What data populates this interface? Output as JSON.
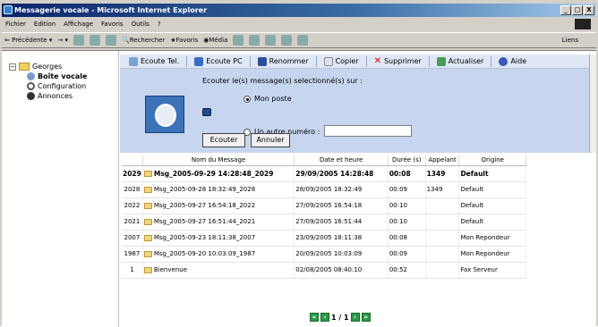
{
  "window": {
    "title": "Messagerie vocale - Microsoft Internet Explorer",
    "buttons": [
      "_",
      "□",
      "X"
    ]
  },
  "menu": [
    "Fichier",
    "Edition",
    "Affichage",
    "Favoris",
    "Outils",
    "?"
  ],
  "nav": {
    "back": "Précédente",
    "search": "Rechercher",
    "favorites": "Favoris",
    "media": "Média",
    "links": "Liens"
  },
  "tree": {
    "root": "Georges",
    "items": [
      "Boîte vocale",
      "Configuration",
      "Annonces"
    ]
  },
  "toolbar": {
    "items": [
      "Ecoute Tel.",
      "Ecoute PC",
      "Renommer",
      "Copier",
      "Supprimer",
      "Actualiser",
      "Aide"
    ]
  },
  "panel": {
    "question": "Ecouter le(s) message(s) selectionné(s) sur :",
    "option1": "Mon poste",
    "option2": "Un autre numéro :",
    "number_value": "",
    "listen_button": "Ecouter",
    "cancel_button": "Annuler"
  },
  "table": {
    "headers": [
      "",
      "Nom du Message",
      "Date et heure",
      "Durée (s)",
      "Appelant",
      "Origine"
    ],
    "rows": [
      {
        "id": "2029",
        "name": "Msg_2005-09-29 14:28:48_2029",
        "date": "29/09/2005 14:28:48",
        "duration": "00:08",
        "caller": "1349",
        "origin": "Default",
        "bold": true
      },
      {
        "id": "2028",
        "name": "Msg_2005-09-28 18:32:49_2028",
        "date": "28/09/2005 18:32:49",
        "duration": "00:09",
        "caller": "1349",
        "origin": "Default"
      },
      {
        "id": "2022",
        "name": "Msg_2005-09-27 16:54:18_2022",
        "date": "27/09/2005 16:54:18",
        "duration": "00:10",
        "caller": "",
        "origin": "Default"
      },
      {
        "id": "2021",
        "name": "Msg_2005-09-27 16:51:44_2021",
        "date": "27/09/2005 16:51:44",
        "duration": "00:10",
        "caller": "",
        "origin": "Default"
      },
      {
        "id": "2007",
        "name": "Msg_2005-09-23 18:11:38_2007",
        "date": "23/09/2005 18:11:38",
        "duration": "00:08",
        "caller": "",
        "origin": "Mon Repondeur"
      },
      {
        "id": "1987",
        "name": "Msg_2005-09-20 10:03:09_1987",
        "date": "20/09/2005 10:03:09",
        "duration": "00:09",
        "caller": "",
        "origin": "Mon Repondeur"
      },
      {
        "id": "1",
        "name": "Bienvenue",
        "date": "02/08/2005 08:40:10",
        "duration": "00:52",
        "caller": "",
        "origin": "Fax Serveur"
      }
    ]
  },
  "pager": {
    "text": "1 / 1"
  }
}
